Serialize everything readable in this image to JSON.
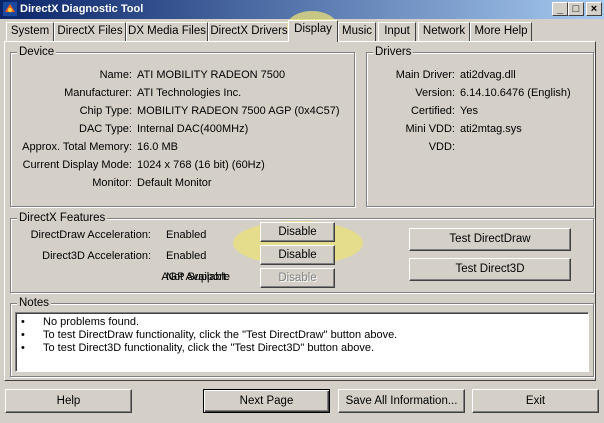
{
  "window": {
    "title": "DirectX Diagnostic Tool"
  },
  "caption_buttons": [
    "_",
    "□",
    "×"
  ],
  "tabs": [
    {
      "label": "System"
    },
    {
      "label": "DirectX Files"
    },
    {
      "label": "DX Media Files"
    },
    {
      "label": "DirectX Drivers"
    },
    {
      "label": "Display"
    },
    {
      "label": "Music"
    },
    {
      "label": "Input"
    },
    {
      "label": "Network"
    },
    {
      "label": "More Help"
    }
  ],
  "active_tab": "Display",
  "device": {
    "legend": "Device",
    "rows": [
      {
        "label": "Name:",
        "value": "ATI MOBILITY RADEON 7500"
      },
      {
        "label": "Manufacturer:",
        "value": "ATI Technologies Inc."
      },
      {
        "label": "Chip Type:",
        "value": "MOBILITY RADEON 7500 AGP (0x4C57)"
      },
      {
        "label": "DAC Type:",
        "value": "Internal DAC(400MHz)"
      },
      {
        "label": "Approx. Total Memory:",
        "value": "16.0 MB"
      },
      {
        "label": "Current Display Mode:",
        "value": "1024 x 768 (16 bit) (60Hz)"
      },
      {
        "label": "Monitor:",
        "value": "Default Monitor"
      }
    ]
  },
  "drivers": {
    "legend": "Drivers",
    "rows": [
      {
        "label": "Main Driver:",
        "value": "ati2dvag.dll"
      },
      {
        "label": "Version:",
        "value": "6.14.10.6476 (English)"
      },
      {
        "label": "Certified:",
        "value": "Yes"
      },
      {
        "label": "Mini VDD:",
        "value": "ati2mtag.sys"
      },
      {
        "label": "VDD:",
        "value": ""
      }
    ]
  },
  "features": {
    "legend": "DirectX Features",
    "rows": [
      {
        "label": "DirectDraw Acceleration:",
        "value": "Enabled",
        "button": "Disable",
        "enabled": true
      },
      {
        "label": "Direct3D Acceleration:",
        "value": "Enabled",
        "button": "Disable",
        "enabled": true
      },
      {
        "label": "AGP Support:",
        "value": "Not Available",
        "button": "Disable",
        "enabled": false
      }
    ],
    "test_directdraw": "Test DirectDraw",
    "test_direct3d": "Test Direct3D"
  },
  "notes": {
    "legend": "Notes",
    "lines": [
      "No problems found.",
      "To test DirectDraw functionality, click the \"Test DirectDraw\" button above.",
      "To test Direct3D functionality, click the \"Test Direct3D\" button above."
    ],
    "bullet": "•"
  },
  "bottom_buttons": {
    "help": "Help",
    "next": "Next Page",
    "save": "Save All Information...",
    "exit": "Exit"
  },
  "colors": {
    "titlebar_start": "#0a246a",
    "titlebar_end": "#a6caf0",
    "face": "#d4d0c8",
    "highlight": "#ebe178"
  }
}
